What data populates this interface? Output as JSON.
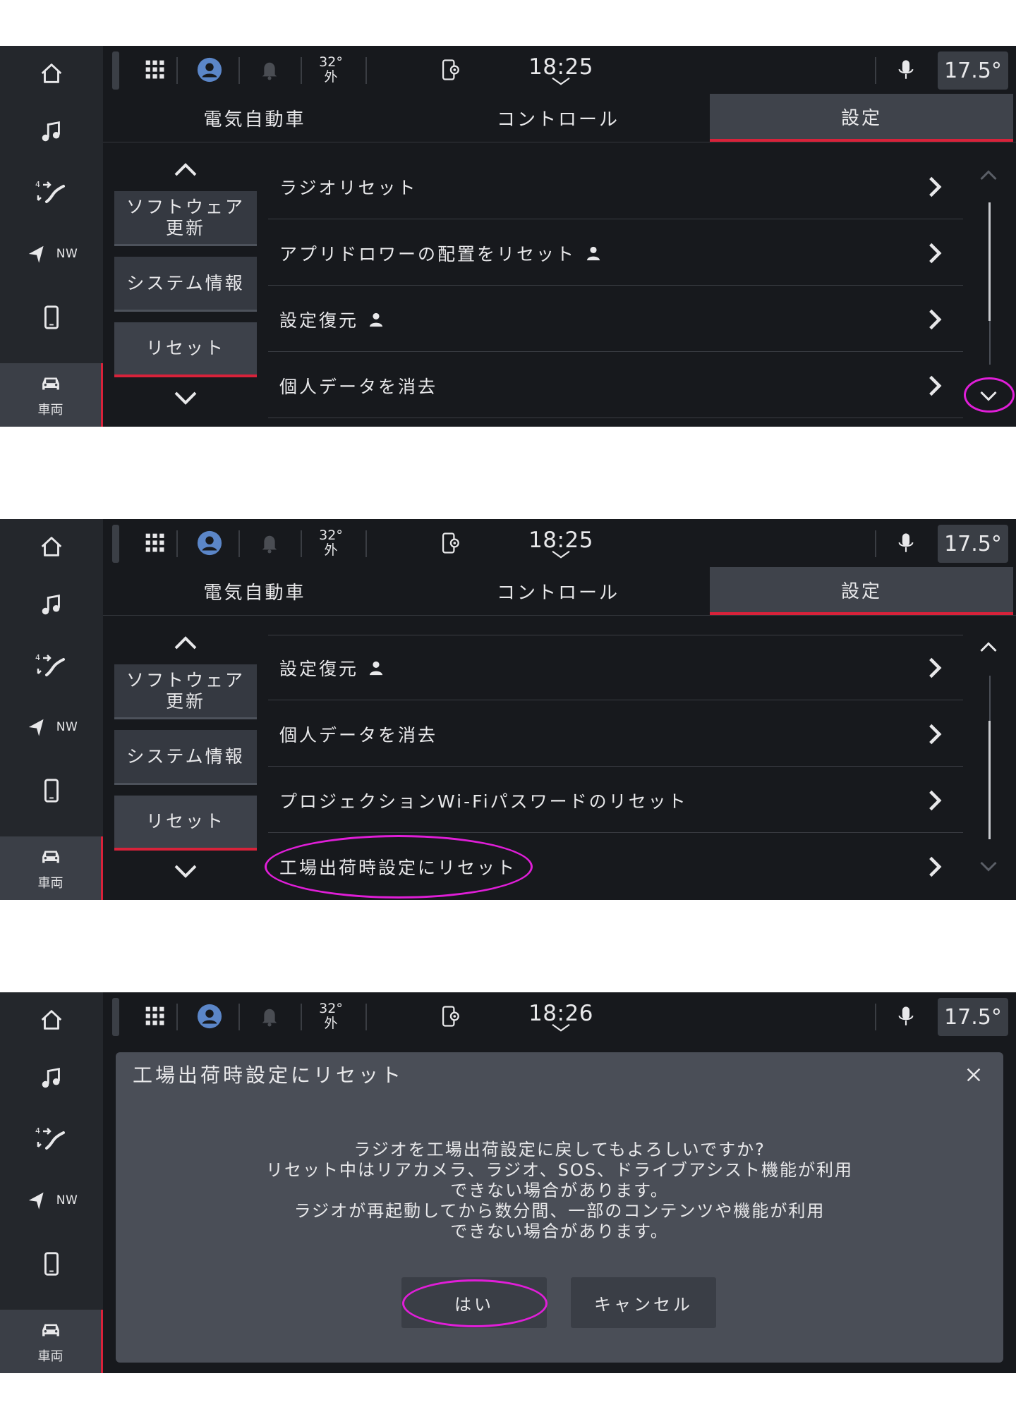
{
  "colors": {
    "accent_red": "#d8223a",
    "annotation_magenta": "#e01ed8",
    "background": "#17191d",
    "panel": "#3f434b"
  },
  "screens": [
    {
      "rail": {
        "nav_label": "NW",
        "vehicle_label": "車両"
      },
      "status": {
        "outside_temp": "32°",
        "outside_label": "外",
        "clock": "18:25",
        "cabin_temp": "17.5°"
      },
      "tabs": [
        "電気自動車",
        "コントロール",
        "設定"
      ],
      "submenu": [
        "ソフトウェア\n更新",
        "システム情報",
        "リセット"
      ],
      "rows": [
        {
          "label": "ラジオリセット",
          "profile_icon": false
        },
        {
          "label": "アプリドロワーの配置をリセット",
          "profile_icon": true
        },
        {
          "label": "設定復元",
          "profile_icon": true
        },
        {
          "label": "個人データを消去",
          "profile_icon": false
        }
      ]
    },
    {
      "rail": {
        "nav_label": "NW",
        "vehicle_label": "車両"
      },
      "status": {
        "outside_temp": "32°",
        "outside_label": "外",
        "clock": "18:25",
        "cabin_temp": "17.5°"
      },
      "tabs": [
        "電気自動車",
        "コントロール",
        "設定"
      ],
      "submenu": [
        "ソフトウェア\n更新",
        "システム情報",
        "リセット"
      ],
      "rows": [
        {
          "label": "設定復元",
          "profile_icon": true
        },
        {
          "label": "個人データを消去",
          "profile_icon": false
        },
        {
          "label": "プロジェクションWi-Fiパスワードのリセット",
          "profile_icon": false
        },
        {
          "label": "工場出荷時設定にリセット",
          "profile_icon": false
        }
      ]
    },
    {
      "rail": {
        "nav_label": "NW",
        "vehicle_label": "車両"
      },
      "status": {
        "outside_temp": "32°",
        "outside_label": "外",
        "clock": "18:26",
        "cabin_temp": "17.5°"
      },
      "dialog": {
        "title": "工場出荷時設定にリセット",
        "message_lines": [
          "ラジオを工場出荷設定に戻してもよろしいですか?",
          "リセット中はリアカメラ、ラジオ、SOS、ドライブアシスト機能が利用",
          "できない場合があります。",
          "ラジオが再起動してから数分間、一部のコンテンツや機能が利用",
          "できない場合があります。"
        ],
        "confirm_label": "はい",
        "cancel_label": "キャンセル"
      }
    }
  ]
}
